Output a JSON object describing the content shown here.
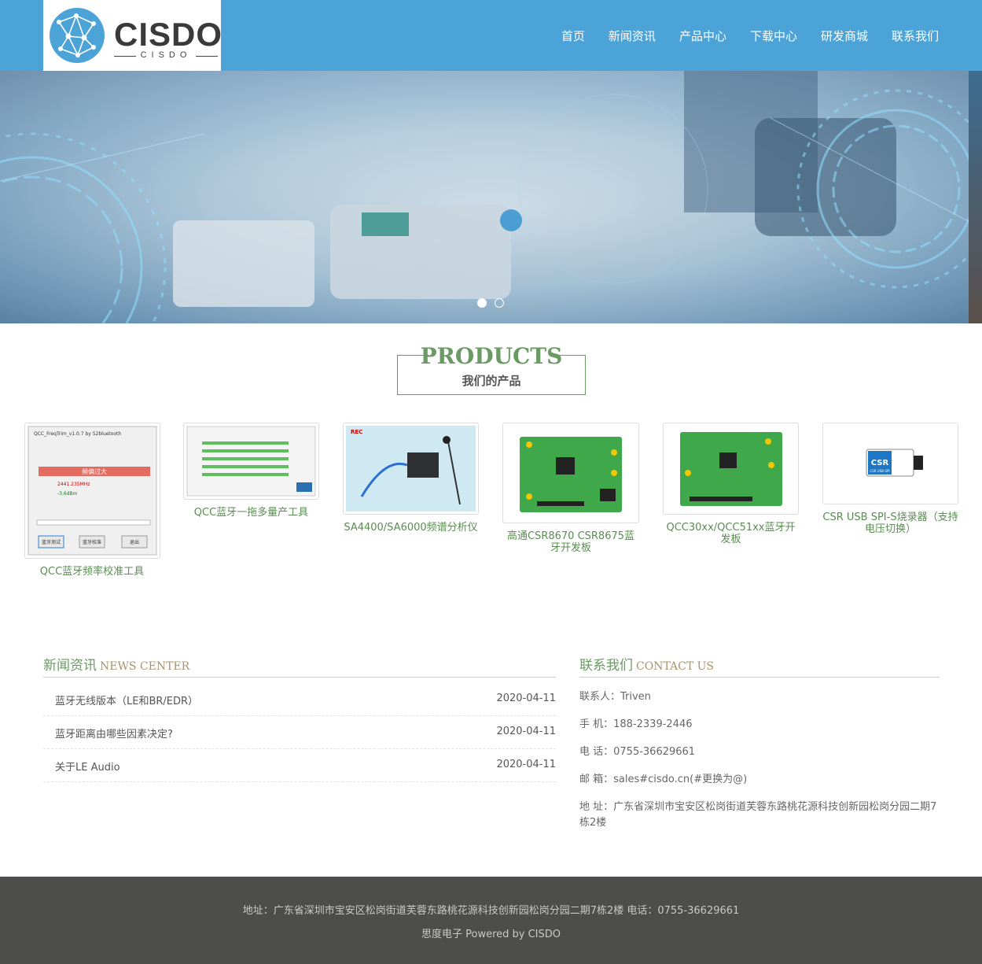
{
  "header": {
    "logo_text": "CISDO",
    "logo_sub": "CISDO",
    "nav": [
      "首页",
      "新闻资讯",
      "产品中心",
      "下载中心",
      "研发商城",
      "联系我们"
    ],
    "color": "#4ba3d7"
  },
  "banner": {
    "slides": 2,
    "active_slide": 1
  },
  "products": {
    "title_en": "PRODUCTS",
    "title_cn": "我们的产品",
    "items": [
      {
        "name": "QCC蓝牙频率校准工具",
        "window_title": "QCC_FreqTrim_v1.0.7 by 52bluetooth",
        "alert": "频偏过大",
        "freq": "2441.235MHz",
        "power": "-3.6dBm",
        "buttons": [
          "蓝牙测试",
          "蓝牙校准",
          "退出"
        ]
      },
      {
        "name": "QCC蓝牙一拖多量产工具"
      },
      {
        "name": "SA4400/SA6000频谱分析仪",
        "badge": "REC"
      },
      {
        "name": "高通CSR8670 CSR8675蓝牙开发板"
      },
      {
        "name": "QCC30xx/QCC51xx蓝牙开发板"
      },
      {
        "name": "CSR USB SPI-S烧录器（支持电压切换）",
        "device_label": "CSR",
        "device_sub": "CSR USB-SPI"
      }
    ]
  },
  "news": {
    "title_cn": "新闻资讯",
    "title_en": "NEWS CENTER",
    "items": [
      {
        "title": "蓝牙无线版本（LE和BR/EDR）",
        "date": "2020-04-11"
      },
      {
        "title": "蓝牙距离由哪些因素决定?",
        "date": "2020-04-11"
      },
      {
        "title": "关于LE Audio",
        "date": "2020-04-11"
      }
    ]
  },
  "contact": {
    "title_cn": "联系我们",
    "title_en": "CONTACT US",
    "lines": [
      "联系人：Triven",
      "手 机：188-2339-2446",
      "电 话：0755-36629661",
      "邮 箱：sales#cisdo.cn(#更换为@)",
      "地 址：广东省深圳市宝安区松岗街道芙蓉东路桃花源科技创新园松岗分园二期7栋2楼"
    ]
  },
  "footer": {
    "line1": "地址：广东省深圳市宝安区松岗街道芙蓉东路桃花源科技创新园松岗分园二期7栋2楼  电话：0755-36629661",
    "line2": "思度电子 Powered by CISDO"
  }
}
